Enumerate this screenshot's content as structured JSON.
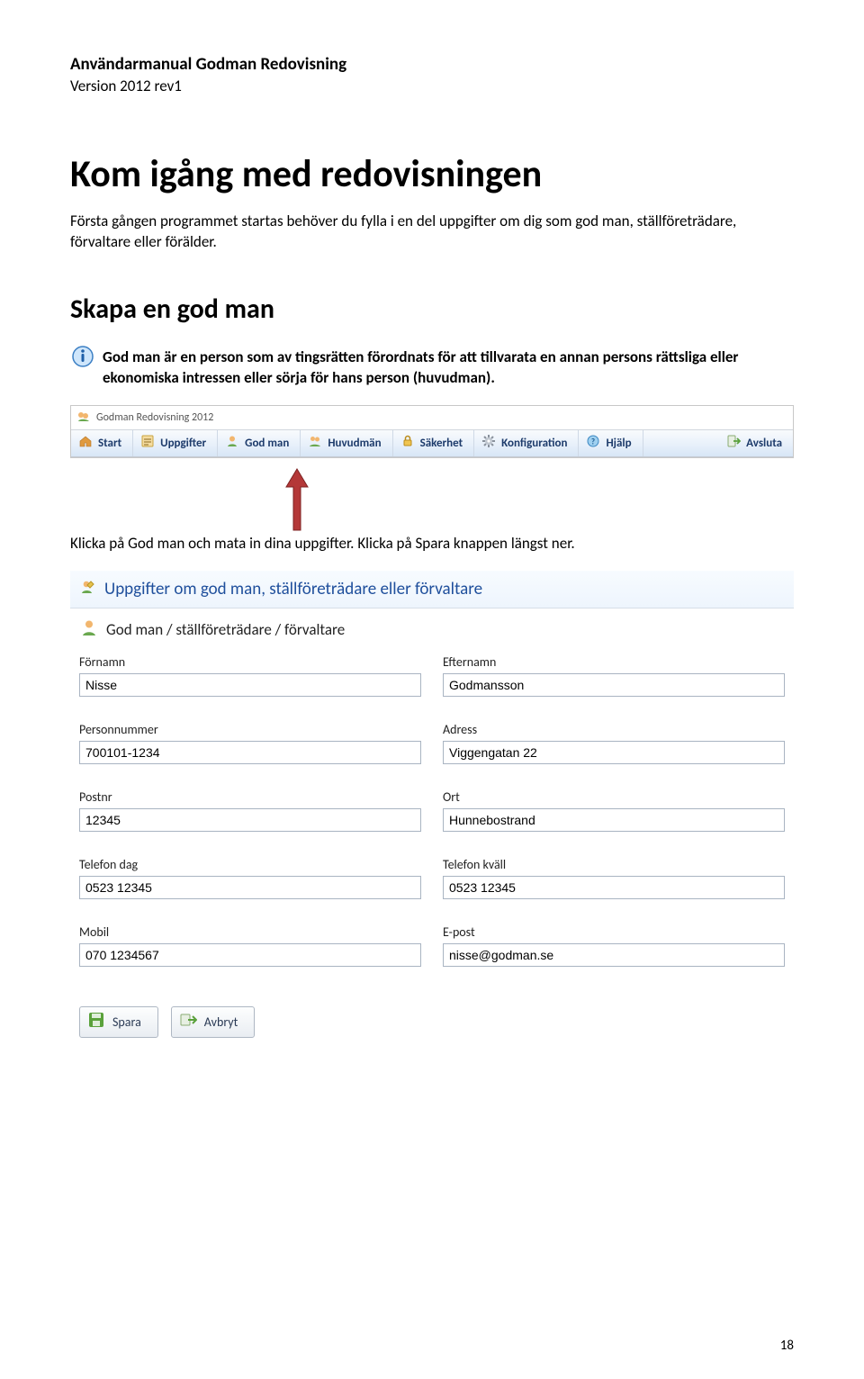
{
  "doc": {
    "header_title": "Användarmanual Godman Redovisning",
    "header_version": "Version 2012 rev1",
    "page_number": "18"
  },
  "sections": {
    "h1": "Kom igång med redovisningen",
    "intro": "Första gången programmet startas behöver du fylla i en del uppgifter om dig som god man, ställföreträdare, förvaltare eller förälder.",
    "h2": "Skapa en god man",
    "info": "God man är en person som av tingsrätten förordnats för att tillvarata en annan persons rättsliga eller ekonomiska intressen eller sörja för hans person (huvudman).",
    "click_text": "Klicka på God man och mata in dina uppgifter. Klicka på Spara knappen längst ner."
  },
  "toolbar": {
    "app_title": "Godman Redovisning 2012",
    "items": [
      {
        "label": "Start"
      },
      {
        "label": "Uppgifter"
      },
      {
        "label": "God man"
      },
      {
        "label": "Huvudmän"
      },
      {
        "label": "Säkerhet"
      },
      {
        "label": "Konfiguration"
      },
      {
        "label": "Hjälp"
      },
      {
        "label": "Avsluta"
      }
    ]
  },
  "form": {
    "header": "Uppgifter om god man, ställföreträdare eller förvaltare",
    "subheader": "God man / ställföreträdare / förvaltare",
    "fields": {
      "fornamn_label": "Förnamn",
      "fornamn_value": "Nisse",
      "efternamn_label": "Efternamn",
      "efternamn_value": "Godmansson",
      "personnummer_label": "Personnummer",
      "personnummer_value": "700101-1234",
      "adress_label": "Adress",
      "adress_value": "Viggengatan 22",
      "postnr_label": "Postnr",
      "postnr_value": "12345",
      "ort_label": "Ort",
      "ort_value": "Hunnebostrand",
      "telefon_dag_label": "Telefon dag",
      "telefon_dag_value": "0523 12345",
      "telefon_kvall_label": "Telefon kväll",
      "telefon_kvall_value": "0523 12345",
      "mobil_label": "Mobil",
      "mobil_value": "070 1234567",
      "epost_label": "E-post",
      "epost_value": "nisse@godman.se"
    },
    "buttons": {
      "spara": "Spara",
      "avbryt": "Avbryt"
    }
  }
}
